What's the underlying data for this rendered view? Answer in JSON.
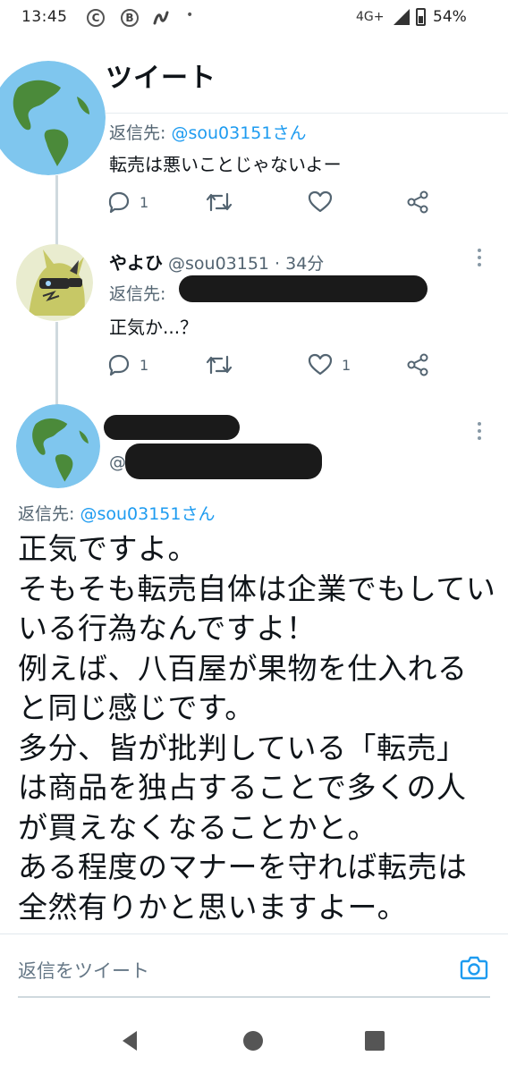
{
  "status_bar": {
    "time": "13:45",
    "notification_icons": [
      "copyright-icon",
      "bitcoin-icon",
      "app-icon"
    ],
    "more_indicator": "•",
    "network": "4G+",
    "battery": "54%",
    "battery_level": 0.54
  },
  "header": {
    "title": "ツイート"
  },
  "tweets": [
    {
      "reply_prefix": "返信先:",
      "reply_handle": "@sou03151さん",
      "text": "転売は悪いことじゃないよー",
      "reply_count": "1",
      "retweet_count": "",
      "like_count": ""
    },
    {
      "name": "やよひ",
      "handle_time": "@sou03151 · 34分",
      "reply_prefix": "返信先:",
      "text": "正気か...？",
      "reply_count": "1",
      "retweet_count": "",
      "like_count": "1"
    }
  ],
  "main_tweet": {
    "handle_prefix": "@",
    "reply_prefix": "返信先:",
    "reply_handle": "@sou03151さん",
    "body_lines": [
      "正気ですよ。",
      "そもそも転売自体は企業でもしてい",
      "いる行為なんですよ！",
      "例えば、八百屋が果物を仕入れる",
      "と同じ感じです。",
      "多分、皆が批判している「転売」",
      "は商品を独占することで多くの人",
      "が買えなくなることかと。",
      "ある程度のマナーを守れば転売は",
      "全然有りかと思いますよー。"
    ]
  },
  "composer": {
    "placeholder": "返信をツイート"
  },
  "colors": {
    "accent": "#1d9bf0",
    "muted": "#536471",
    "text": "#0f1419"
  }
}
